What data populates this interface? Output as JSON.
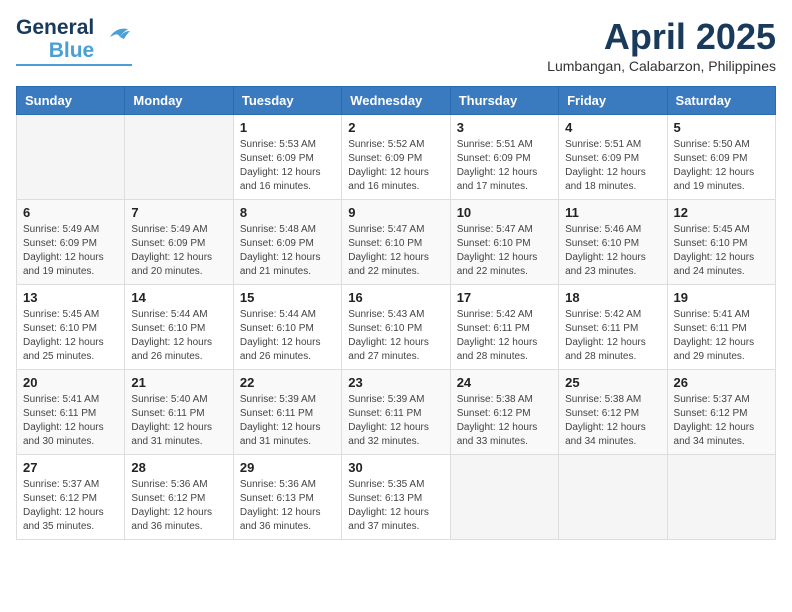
{
  "header": {
    "logo_general": "General",
    "logo_blue": "Blue",
    "month": "April 2025",
    "location": "Lumbangan, Calabarzon, Philippines"
  },
  "weekdays": [
    "Sunday",
    "Monday",
    "Tuesday",
    "Wednesday",
    "Thursday",
    "Friday",
    "Saturday"
  ],
  "weeks": [
    [
      {
        "day": "",
        "sunrise": "",
        "sunset": "",
        "daylight": ""
      },
      {
        "day": "",
        "sunrise": "",
        "sunset": "",
        "daylight": ""
      },
      {
        "day": "1",
        "sunrise": "Sunrise: 5:53 AM",
        "sunset": "Sunset: 6:09 PM",
        "daylight": "Daylight: 12 hours and 16 minutes."
      },
      {
        "day": "2",
        "sunrise": "Sunrise: 5:52 AM",
        "sunset": "Sunset: 6:09 PM",
        "daylight": "Daylight: 12 hours and 16 minutes."
      },
      {
        "day": "3",
        "sunrise": "Sunrise: 5:51 AM",
        "sunset": "Sunset: 6:09 PM",
        "daylight": "Daylight: 12 hours and 17 minutes."
      },
      {
        "day": "4",
        "sunrise": "Sunrise: 5:51 AM",
        "sunset": "Sunset: 6:09 PM",
        "daylight": "Daylight: 12 hours and 18 minutes."
      },
      {
        "day": "5",
        "sunrise": "Sunrise: 5:50 AM",
        "sunset": "Sunset: 6:09 PM",
        "daylight": "Daylight: 12 hours and 19 minutes."
      }
    ],
    [
      {
        "day": "6",
        "sunrise": "Sunrise: 5:49 AM",
        "sunset": "Sunset: 6:09 PM",
        "daylight": "Daylight: 12 hours and 19 minutes."
      },
      {
        "day": "7",
        "sunrise": "Sunrise: 5:49 AM",
        "sunset": "Sunset: 6:09 PM",
        "daylight": "Daylight: 12 hours and 20 minutes."
      },
      {
        "day": "8",
        "sunrise": "Sunrise: 5:48 AM",
        "sunset": "Sunset: 6:09 PM",
        "daylight": "Daylight: 12 hours and 21 minutes."
      },
      {
        "day": "9",
        "sunrise": "Sunrise: 5:47 AM",
        "sunset": "Sunset: 6:10 PM",
        "daylight": "Daylight: 12 hours and 22 minutes."
      },
      {
        "day": "10",
        "sunrise": "Sunrise: 5:47 AM",
        "sunset": "Sunset: 6:10 PM",
        "daylight": "Daylight: 12 hours and 22 minutes."
      },
      {
        "day": "11",
        "sunrise": "Sunrise: 5:46 AM",
        "sunset": "Sunset: 6:10 PM",
        "daylight": "Daylight: 12 hours and 23 minutes."
      },
      {
        "day": "12",
        "sunrise": "Sunrise: 5:45 AM",
        "sunset": "Sunset: 6:10 PM",
        "daylight": "Daylight: 12 hours and 24 minutes."
      }
    ],
    [
      {
        "day": "13",
        "sunrise": "Sunrise: 5:45 AM",
        "sunset": "Sunset: 6:10 PM",
        "daylight": "Daylight: 12 hours and 25 minutes."
      },
      {
        "day": "14",
        "sunrise": "Sunrise: 5:44 AM",
        "sunset": "Sunset: 6:10 PM",
        "daylight": "Daylight: 12 hours and 26 minutes."
      },
      {
        "day": "15",
        "sunrise": "Sunrise: 5:44 AM",
        "sunset": "Sunset: 6:10 PM",
        "daylight": "Daylight: 12 hours and 26 minutes."
      },
      {
        "day": "16",
        "sunrise": "Sunrise: 5:43 AM",
        "sunset": "Sunset: 6:10 PM",
        "daylight": "Daylight: 12 hours and 27 minutes."
      },
      {
        "day": "17",
        "sunrise": "Sunrise: 5:42 AM",
        "sunset": "Sunset: 6:11 PM",
        "daylight": "Daylight: 12 hours and 28 minutes."
      },
      {
        "day": "18",
        "sunrise": "Sunrise: 5:42 AM",
        "sunset": "Sunset: 6:11 PM",
        "daylight": "Daylight: 12 hours and 28 minutes."
      },
      {
        "day": "19",
        "sunrise": "Sunrise: 5:41 AM",
        "sunset": "Sunset: 6:11 PM",
        "daylight": "Daylight: 12 hours and 29 minutes."
      }
    ],
    [
      {
        "day": "20",
        "sunrise": "Sunrise: 5:41 AM",
        "sunset": "Sunset: 6:11 PM",
        "daylight": "Daylight: 12 hours and 30 minutes."
      },
      {
        "day": "21",
        "sunrise": "Sunrise: 5:40 AM",
        "sunset": "Sunset: 6:11 PM",
        "daylight": "Daylight: 12 hours and 31 minutes."
      },
      {
        "day": "22",
        "sunrise": "Sunrise: 5:39 AM",
        "sunset": "Sunset: 6:11 PM",
        "daylight": "Daylight: 12 hours and 31 minutes."
      },
      {
        "day": "23",
        "sunrise": "Sunrise: 5:39 AM",
        "sunset": "Sunset: 6:11 PM",
        "daylight": "Daylight: 12 hours and 32 minutes."
      },
      {
        "day": "24",
        "sunrise": "Sunrise: 5:38 AM",
        "sunset": "Sunset: 6:12 PM",
        "daylight": "Daylight: 12 hours and 33 minutes."
      },
      {
        "day": "25",
        "sunrise": "Sunrise: 5:38 AM",
        "sunset": "Sunset: 6:12 PM",
        "daylight": "Daylight: 12 hours and 34 minutes."
      },
      {
        "day": "26",
        "sunrise": "Sunrise: 5:37 AM",
        "sunset": "Sunset: 6:12 PM",
        "daylight": "Daylight: 12 hours and 34 minutes."
      }
    ],
    [
      {
        "day": "27",
        "sunrise": "Sunrise: 5:37 AM",
        "sunset": "Sunset: 6:12 PM",
        "daylight": "Daylight: 12 hours and 35 minutes."
      },
      {
        "day": "28",
        "sunrise": "Sunrise: 5:36 AM",
        "sunset": "Sunset: 6:12 PM",
        "daylight": "Daylight: 12 hours and 36 minutes."
      },
      {
        "day": "29",
        "sunrise": "Sunrise: 5:36 AM",
        "sunset": "Sunset: 6:13 PM",
        "daylight": "Daylight: 12 hours and 36 minutes."
      },
      {
        "day": "30",
        "sunrise": "Sunrise: 5:35 AM",
        "sunset": "Sunset: 6:13 PM",
        "daylight": "Daylight: 12 hours and 37 minutes."
      },
      {
        "day": "",
        "sunrise": "",
        "sunset": "",
        "daylight": ""
      },
      {
        "day": "",
        "sunrise": "",
        "sunset": "",
        "daylight": ""
      },
      {
        "day": "",
        "sunrise": "",
        "sunset": "",
        "daylight": ""
      }
    ]
  ]
}
